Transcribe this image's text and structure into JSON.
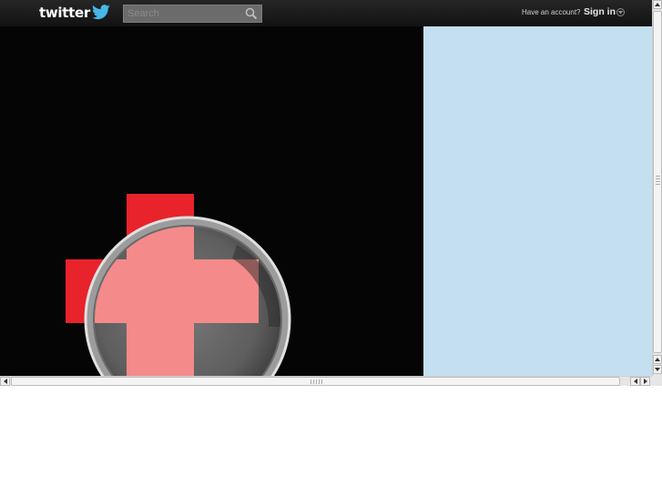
{
  "header": {
    "logo_text": "twitter",
    "search_placeholder": "Search",
    "have_account": "Have an account?",
    "signin_label": "Sign in"
  },
  "colors": {
    "topbar": "#1a1a1a",
    "content_left": "#050505",
    "content_right": "#c4dff0",
    "cross_red": "#e8232b",
    "lens_tint": "#f58a8a"
  },
  "icons": {
    "logo_bird": "twitter-bird-icon",
    "search": "search-icon",
    "signin_toggle": "chevron-down-icon",
    "scroll_up": "arrow-up-icon",
    "scroll_down": "arrow-down-icon",
    "scroll_left": "arrow-left-icon",
    "scroll_right": "arrow-right-icon"
  }
}
